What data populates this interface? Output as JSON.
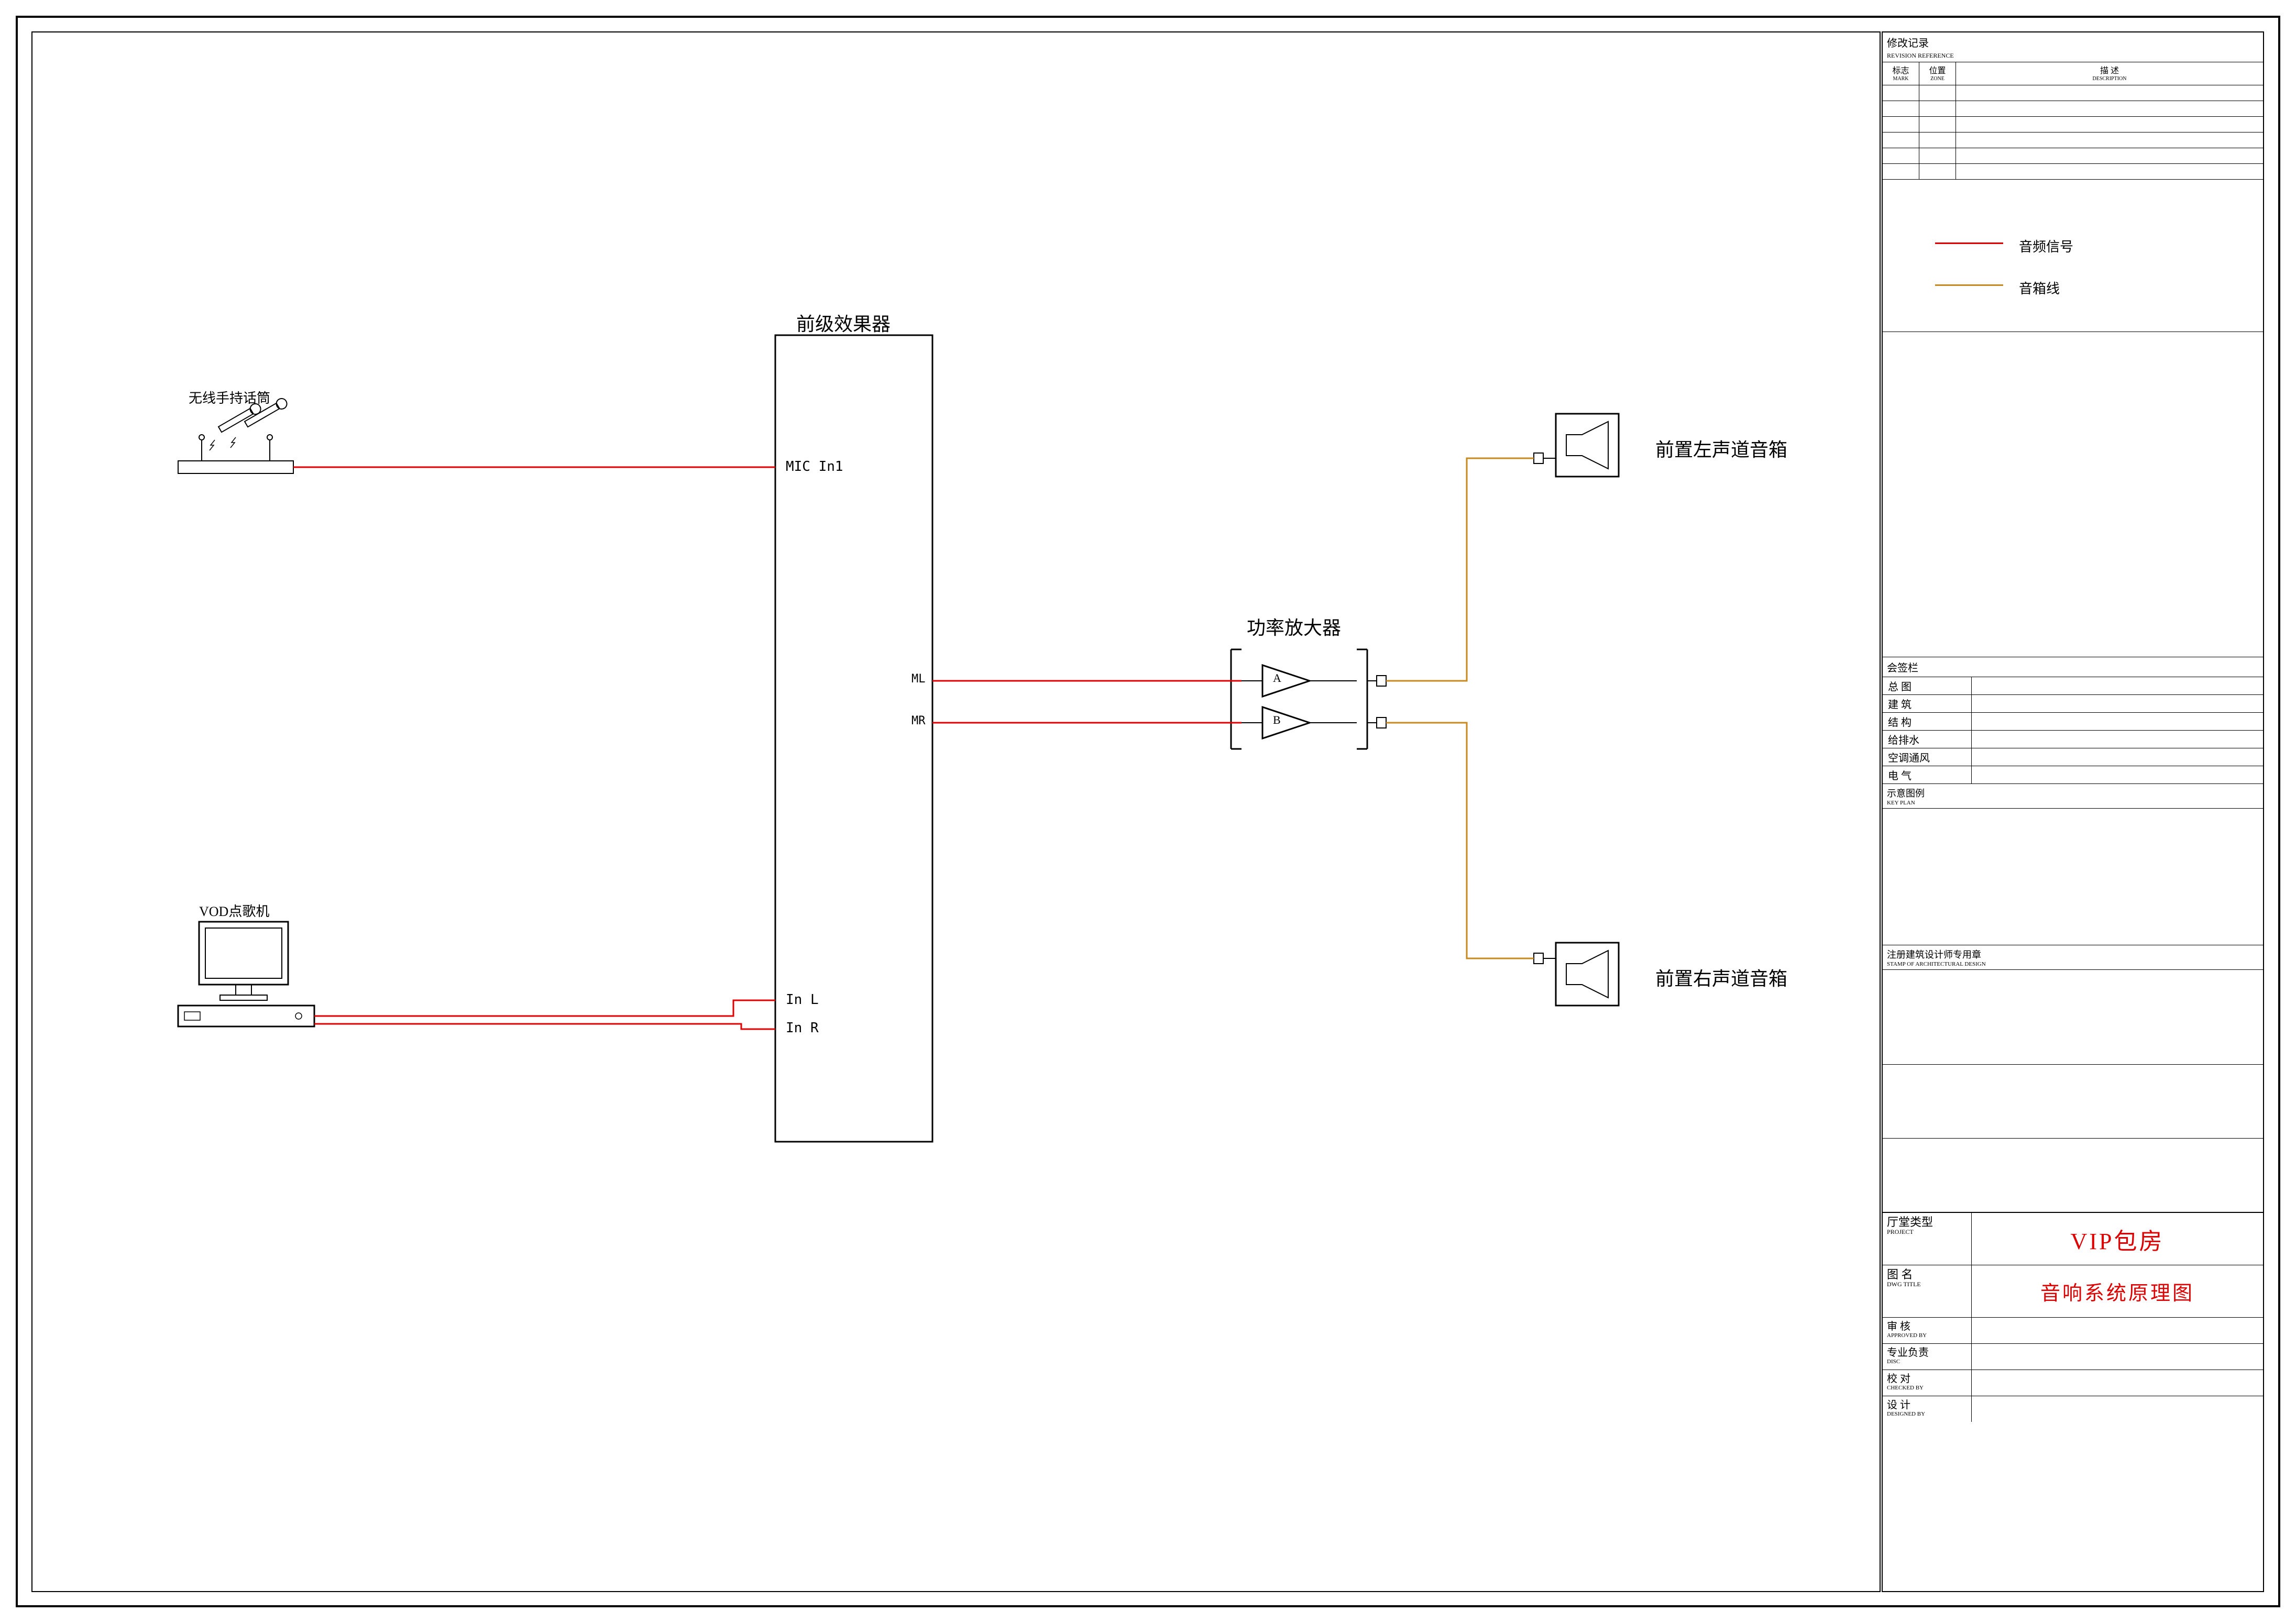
{
  "legend": {
    "audio_signal": "音频信号",
    "speaker_cable": "音箱线"
  },
  "diagram": {
    "mic_label": "无线手持话筒",
    "vod_label": "VOD点歌机",
    "processor_title": "前级效果器",
    "mic_in1": "MIC In1",
    "in_l": "In L",
    "in_r": "In R",
    "ml": "ML",
    "mr": "MR",
    "amp_title": "功率放大器",
    "amp_a": "A",
    "amp_b": "B",
    "speaker_left": "前置左声道音箱",
    "speaker_right": "前置右声道音箱"
  },
  "title_block": {
    "revision_header": {
      "title": "修改记录",
      "title_en": "REVISION REFERENCE",
      "c1": "标志",
      "c1en": "MARK",
      "c2": "位置",
      "c2en": "ZONE",
      "c3": "描  述",
      "c3en": "DESCRIPTION"
    },
    "signature_header": "会签栏",
    "signatures": [
      "总 图",
      "建 筑",
      "结 构",
      "给排水",
      "空调通风",
      "电 气"
    ],
    "plan_header": "示意图例",
    "plan_header_en": "KEY PLAN",
    "stamp_header": "注册建筑设计师专用章",
    "stamp_header_en": "STAMP OF ARCHITECTURAL DESIGN",
    "hall_label": "厅堂类型",
    "hall_label_en": "PROJECT",
    "hall_value": "VIP包房",
    "drawing_label": "图 名",
    "drawing_label_en": "DWG TITLE",
    "drawing_value": "音响系统原理图",
    "rows": [
      {
        "l": "审 核",
        "len": "APPROVED BY"
      },
      {
        "l": "专业负责",
        "len": "DISC"
      },
      {
        "l": "校 对",
        "len": "CHECKED BY"
      },
      {
        "l": "设 计",
        "len": "DESIGNED BY"
      }
    ]
  }
}
